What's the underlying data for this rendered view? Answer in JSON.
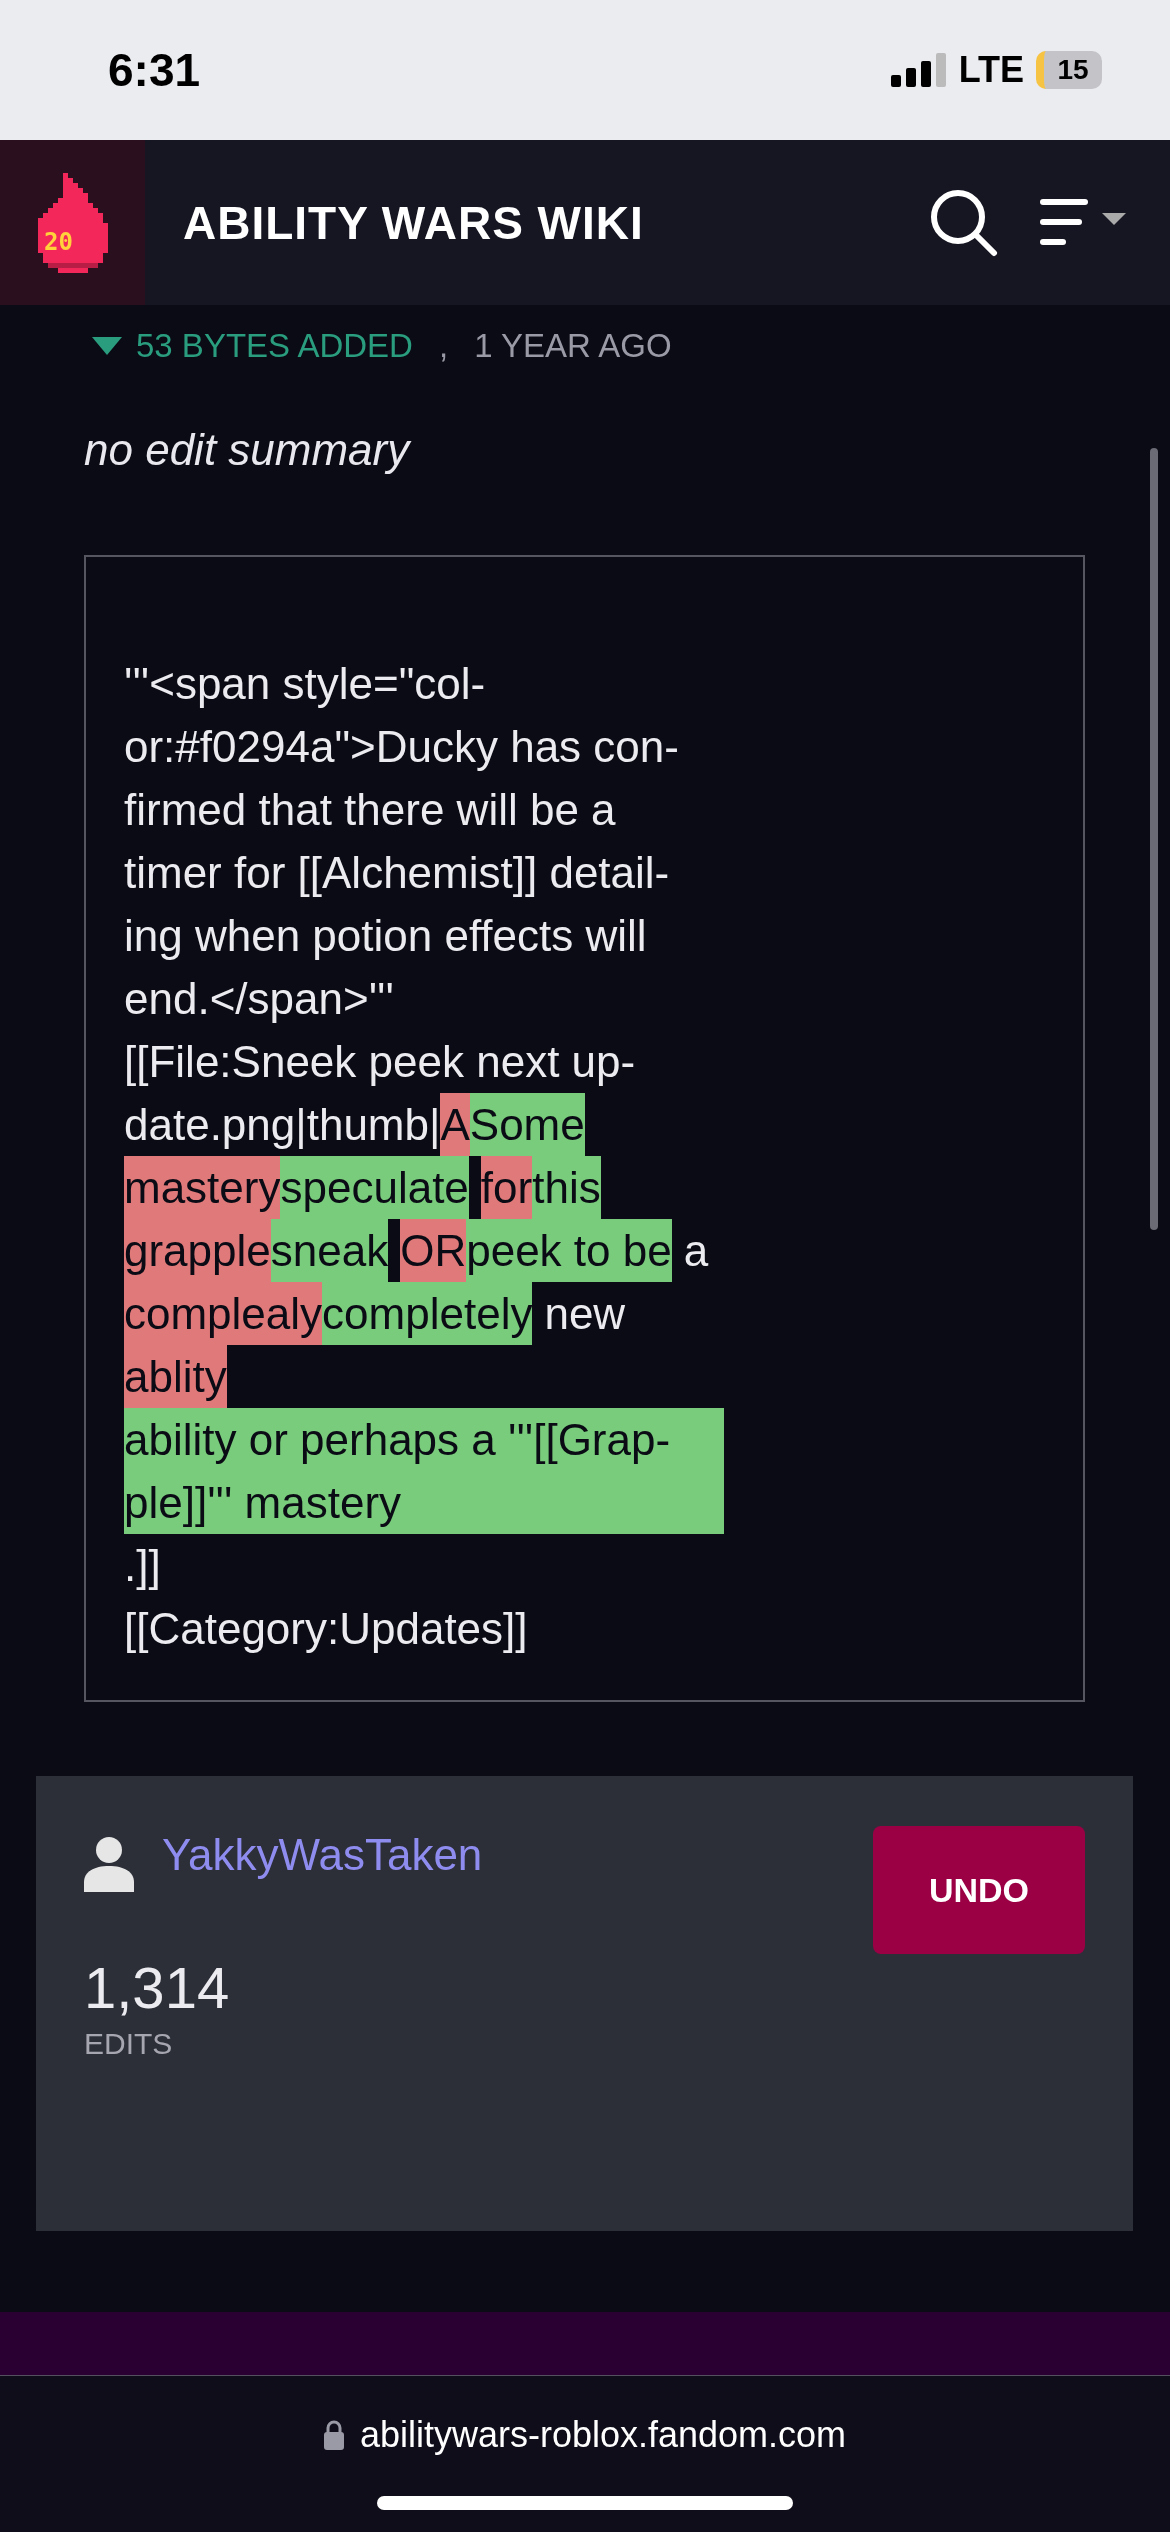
{
  "status_bar": {
    "time": "6:31",
    "network": "LTE",
    "battery": "15"
  },
  "header": {
    "logo_badge": "20",
    "title": "ABILITY WARS WIKI"
  },
  "revision": {
    "size_change": "53 BYTES ADDED",
    "separator": ",",
    "age": "1 YEAR AGO",
    "summary": "no edit summary"
  },
  "diff_lines": [
    [
      {
        "kind": "plain",
        "text": "'''<span style=\"col-"
      }
    ],
    [
      {
        "kind": "plain",
        "text": "or:#f0294a\">Ducky has con-"
      }
    ],
    [
      {
        "kind": "plain",
        "text": "firmed that there will be a"
      }
    ],
    [
      {
        "kind": "plain",
        "text": "timer for [[Alchemist]] detail-"
      }
    ],
    [
      {
        "kind": "plain",
        "text": "ing when potion effects will"
      }
    ],
    [
      {
        "kind": "plain",
        "text": "end.</span>'''"
      }
    ],
    [
      {
        "kind": "plain",
        "text": "[[File:Sneek peek next up-"
      }
    ],
    [
      {
        "kind": "plain",
        "text": "date.png|thumb|"
      },
      {
        "kind": "deleted",
        "text": "A"
      },
      {
        "kind": "added",
        "text": "Some"
      }
    ],
    [
      {
        "kind": "deleted",
        "text": "mastery"
      },
      {
        "kind": "added",
        "text": "speculate"
      },
      {
        "kind": "deleted",
        "text": "for",
        "gap_before": true
      },
      {
        "kind": "added",
        "text": "this"
      }
    ],
    [
      {
        "kind": "deleted",
        "text": "grapple"
      },
      {
        "kind": "added",
        "text": "sneak"
      },
      {
        "kind": "deleted",
        "text": "OR",
        "gap_before": true
      },
      {
        "kind": "added",
        "text": "peek to be"
      },
      {
        "kind": "plain",
        "text": "a",
        "gap_before": true
      }
    ],
    [
      {
        "kind": "deleted",
        "text": "complealy"
      },
      {
        "kind": "added",
        "text": "completely"
      },
      {
        "kind": "plain",
        "text": "new",
        "gap_before": true
      }
    ],
    [
      {
        "kind": "deleted",
        "text": "ablity"
      }
    ],
    [
      {
        "kind": "added_block",
        "text": "ability or perhaps a '''[[Grap-\nple]]''' mastery"
      }
    ],
    [
      {
        "kind": "plain",
        "text": ".]]"
      }
    ],
    [
      {
        "kind": "plain",
        "text": "[[Category:Updates]]"
      }
    ]
  ],
  "author": {
    "name": "YakkyWasTaken",
    "action": "UNDO",
    "edit_count": "1,314",
    "edit_label": "EDITS"
  },
  "browser": {
    "url": "abilitywars-roblox.fandom.com"
  }
}
